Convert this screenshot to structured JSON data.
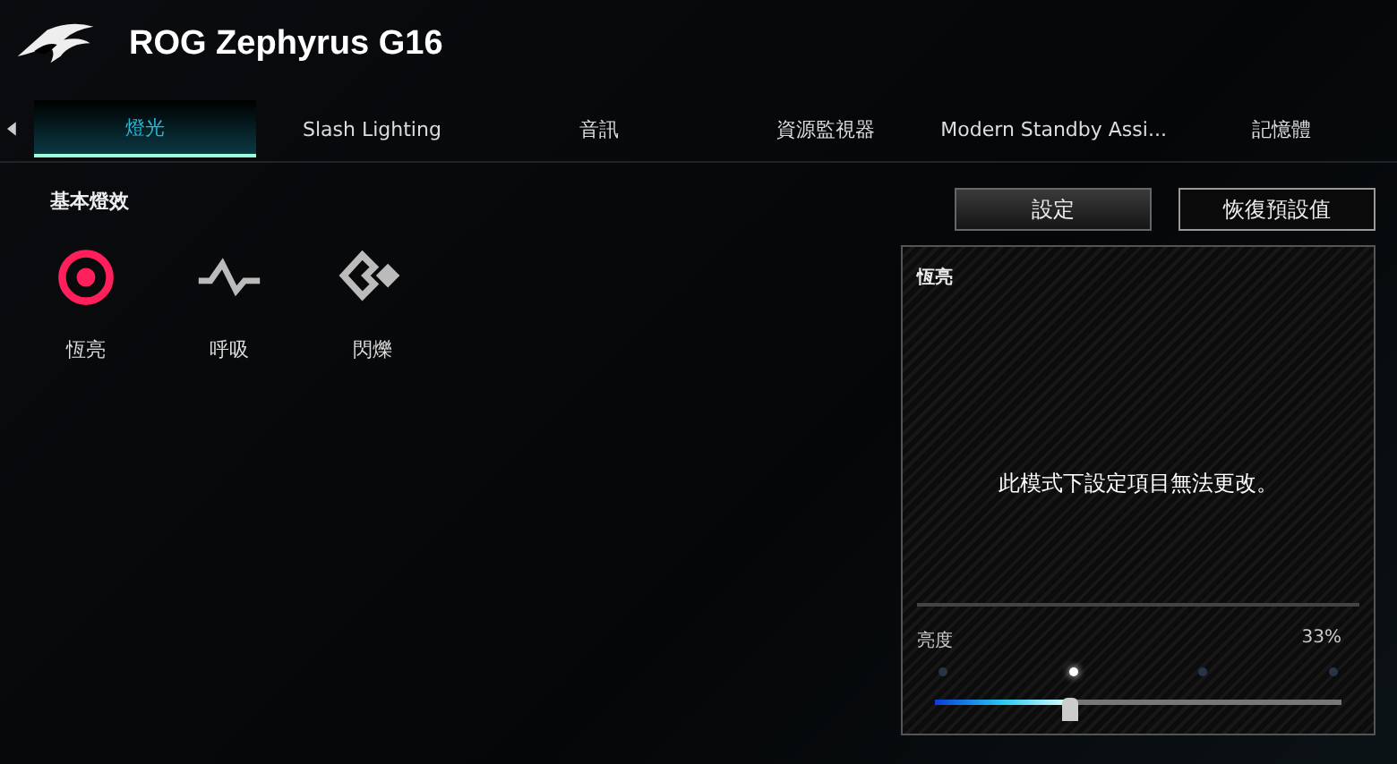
{
  "window": {
    "title": "ROG Zephyrus G16"
  },
  "tabs": [
    {
      "label": "燈光",
      "selected": true
    },
    {
      "label": "Slash Lighting",
      "selected": false
    },
    {
      "label": "音訊",
      "selected": false
    },
    {
      "label": "資源監視器",
      "selected": false
    },
    {
      "label": "Modern Standby Assi...",
      "selected": false
    },
    {
      "label": "記憶體",
      "selected": false
    }
  ],
  "section_title": "基本燈效",
  "effects": [
    {
      "label": "恆亮",
      "kind": "static",
      "selected": true
    },
    {
      "label": "呼吸",
      "kind": "breathing",
      "selected": false
    },
    {
      "label": "閃爍",
      "kind": "strobe",
      "selected": false
    }
  ],
  "buttons": [
    {
      "label": "設定",
      "kind": "settings"
    },
    {
      "label": "恢復預設值",
      "kind": "reset"
    }
  ],
  "panel": {
    "title": "恆亮",
    "message": "此模式下設定項目無法更改。",
    "brightness": {
      "label": "亮度",
      "reading": "33%",
      "level": 0.33,
      "steps": [
        {
          "selected": false
        },
        {
          "selected": true
        },
        {
          "selected": false
        },
        {
          "selected": false
        }
      ]
    }
  }
}
